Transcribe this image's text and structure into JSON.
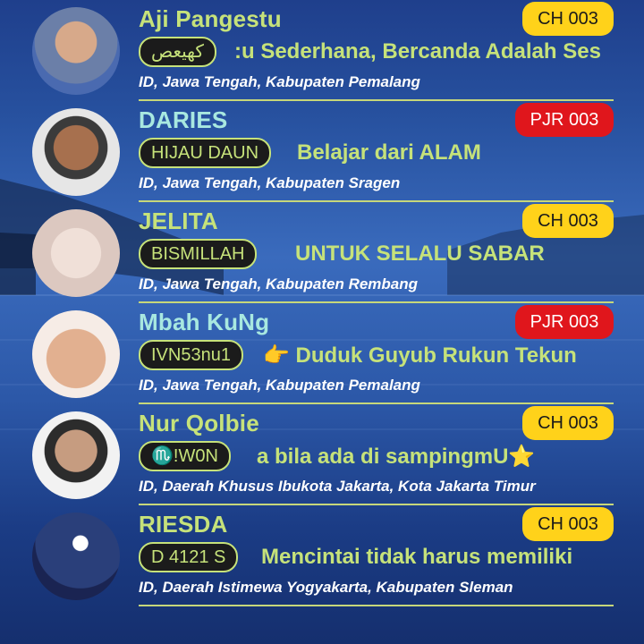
{
  "users": [
    {
      "name": "Aji Pangestu",
      "name_color": "#c6e27a",
      "badge": "CH 003",
      "badge_type": "ch",
      "tag": "كهيعص",
      "status": ":u Sederhana, Bercanda Adalah Ses",
      "location": "ID, Jawa Tengah, Kabupaten Pemalang",
      "avatar_icon": "man-sunglasses-avatar"
    },
    {
      "name": "DARIES",
      "name_color": "#a8e8e0",
      "badge": "PJR 003",
      "badge_type": "pjr",
      "tag": "HIJAU DAUN",
      "status": "Belajar dari ALAM",
      "location": "ID, Jawa Tengah, Kabupaten Sragen",
      "avatar_icon": "man-avatar"
    },
    {
      "name": "JELITA",
      "name_color": "#c6e27a",
      "badge": "CH 003",
      "badge_type": "ch",
      "tag": "BISMILLAH",
      "status": "UNTUK  SELALU   SABAR",
      "location": "ID, Jawa Tengah, Kabupaten Rembang",
      "avatar_icon": "woman-eyes-avatar"
    },
    {
      "name": "Mbah KuNg",
      "name_color": "#a8e8e0",
      "badge": "PJR 003",
      "badge_type": "pjr",
      "tag": "IVN53nu1",
      "status": "👉 Duduk Guyub Rukun Tekun",
      "location": "ID, Jawa Tengah, Kabupaten Pemalang",
      "avatar_icon": "hand-avatar"
    },
    {
      "name": "Nur Qolbie",
      "name_color": "#c6e27a",
      "badge": "CH 003",
      "badge_type": "ch",
      "tag": "♏!W0N",
      "status": "a bila ada di sampingmU⭐",
      "location": "ID, Daerah Khusus Ibukota Jakarta, Kota Jakarta Timur",
      "avatar_icon": "young-man-avatar"
    },
    {
      "name": "RIESDA",
      "name_color": "#c6e27a",
      "badge": "CH 003",
      "badge_type": "ch",
      "tag": "D 4121 S",
      "status": "Mencintai tidak harus memiliki",
      "location": "ID, Daerah Istimewa Yogyakarta, Kabupaten Sleman",
      "avatar_icon": "couple-moon-avatar"
    }
  ]
}
